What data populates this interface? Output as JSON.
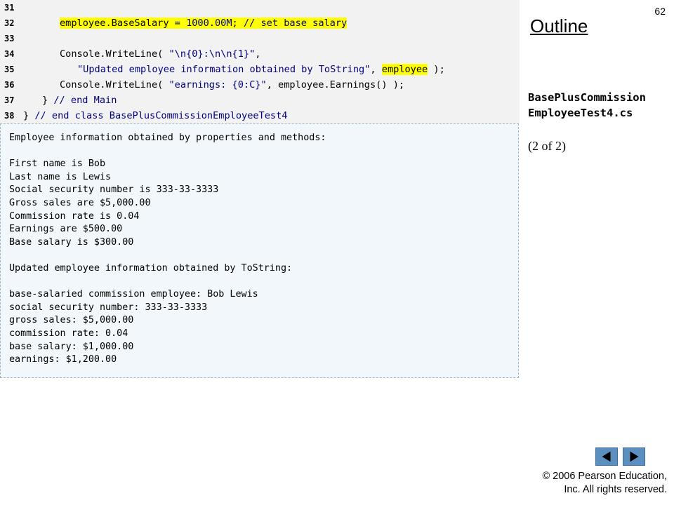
{
  "page_number": "62",
  "sidebar": {
    "outline_title": "Outline",
    "file_name_line1": "BasePlusCommission",
    "file_name_line2": "EmployeeTest4.cs",
    "part_label": "(2 of 2)"
  },
  "code_lines": [
    {
      "num": "31",
      "segments": []
    },
    {
      "num": "32",
      "segments": [
        {
          "text": "employee.BaseSalary = ",
          "style": "hl"
        },
        {
          "text": "1000.00M",
          "style": "hl kw"
        },
        {
          "text": "; ",
          "style": "hl"
        },
        {
          "text": "// set base salary",
          "style": "hl cm"
        }
      ]
    },
    {
      "num": "33",
      "segments": []
    },
    {
      "num": "34",
      "segments": [
        {
          "text": "Console.WriteLine( ",
          "style": ""
        },
        {
          "text": "\"\\n{0}:\\n\\n{1}\"",
          "style": "str"
        },
        {
          "text": ",",
          "style": ""
        }
      ]
    },
    {
      "num": "35",
      "segments": [
        {
          "text": "\"Updated employee information obtained by ToString\"",
          "style": "str"
        },
        {
          "text": ", ",
          "style": ""
        },
        {
          "text": "employee",
          "style": "hl"
        },
        {
          "text": " );",
          "style": ""
        }
      ]
    },
    {
      "num": "36",
      "segments": [
        {
          "text": "Console.WriteLine( ",
          "style": ""
        },
        {
          "text": "\"earnings: {0:C}\"",
          "style": "str"
        },
        {
          "text": ", employee.Earnings() );",
          "style": ""
        }
      ]
    },
    {
      "num": "37",
      "segments": [
        {
          "text": "} ",
          "style": ""
        },
        {
          "text": "// end Main",
          "style": "cm"
        }
      ]
    },
    {
      "num": "38",
      "segments": [
        {
          "text": "} ",
          "style": ""
        },
        {
          "text": "// end class BasePlusCommissionEmployeeTest4",
          "style": "cm"
        }
      ]
    }
  ],
  "output_lines": [
    "Employee information obtained by properties and methods:",
    "",
    "First name is Bob",
    "Last name is Lewis",
    "Social security number is 333-33-3333",
    "Gross sales are $5,000.00",
    "Commission rate is 0.04",
    "Earnings are $500.00",
    "Base salary is $300.00",
    "",
    "Updated employee information obtained by ToString:",
    "",
    "base-salaried commission employee: Bob Lewis",
    "social security number: 333-33-3333",
    "gross sales: $5,000.00",
    "commission rate: 0.04",
    "base salary: $1,000.00",
    "earnings: $1,200.00"
  ],
  "footer": {
    "copyright_line1": "© 2006 Pearson Education,",
    "copyright_line2": "Inc.  All rights reserved."
  },
  "nav": {
    "prev_icon": "left-triangle-icon",
    "next_icon": "right-triangle-icon",
    "button_color": "#5b8fbf"
  }
}
